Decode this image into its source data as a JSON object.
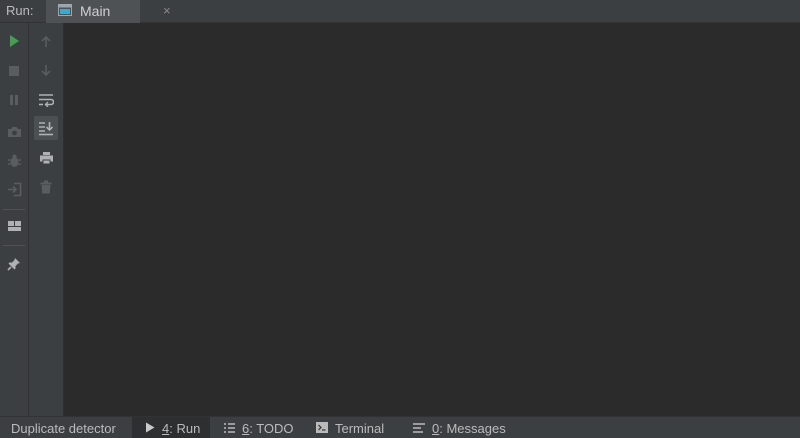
{
  "header": {
    "run_label": "Run:",
    "tab": {
      "label": "Main",
      "close_glyph": "×",
      "icon": "console-window-icon"
    }
  },
  "toolbar_outer": [
    {
      "icon": "run-icon",
      "enabled": true,
      "color": "#499c54"
    },
    {
      "icon": "stop-icon",
      "enabled": false
    },
    {
      "icon": "pause-icon",
      "enabled": false
    },
    {
      "icon": "camera-icon",
      "enabled": false
    },
    {
      "icon": "debug-bug-icon",
      "enabled": false
    },
    {
      "icon": "login-exit-icon",
      "enabled": false
    },
    {
      "icon": "layout-icon",
      "enabled": true
    },
    {
      "icon": "pin-icon",
      "enabled": true
    }
  ],
  "toolbar_inner": [
    {
      "icon": "arrow-up-icon",
      "enabled": false
    },
    {
      "icon": "arrow-down-icon",
      "enabled": false
    },
    {
      "icon": "soft-wrap-icon",
      "enabled": true
    },
    {
      "icon": "scroll-to-end-icon",
      "enabled": true,
      "selected": true
    },
    {
      "icon": "print-icon",
      "enabled": true
    },
    {
      "icon": "trash-icon",
      "enabled": false
    }
  ],
  "bottom_bar": {
    "duplicate_detector": "Duplicate detector",
    "run": {
      "mnemonic": "4",
      "rest": ": Run",
      "active": true
    },
    "todo": {
      "mnemonic": "6",
      "rest": ": TODO"
    },
    "terminal": {
      "label": "Terminal"
    },
    "messages": {
      "mnemonic": "0",
      "rest": ": Messages"
    }
  },
  "colors": {
    "panel": "#3c3f41",
    "console_background": "#2b2b2b",
    "run_green": "#499c54",
    "text": "#bbbbbb"
  }
}
